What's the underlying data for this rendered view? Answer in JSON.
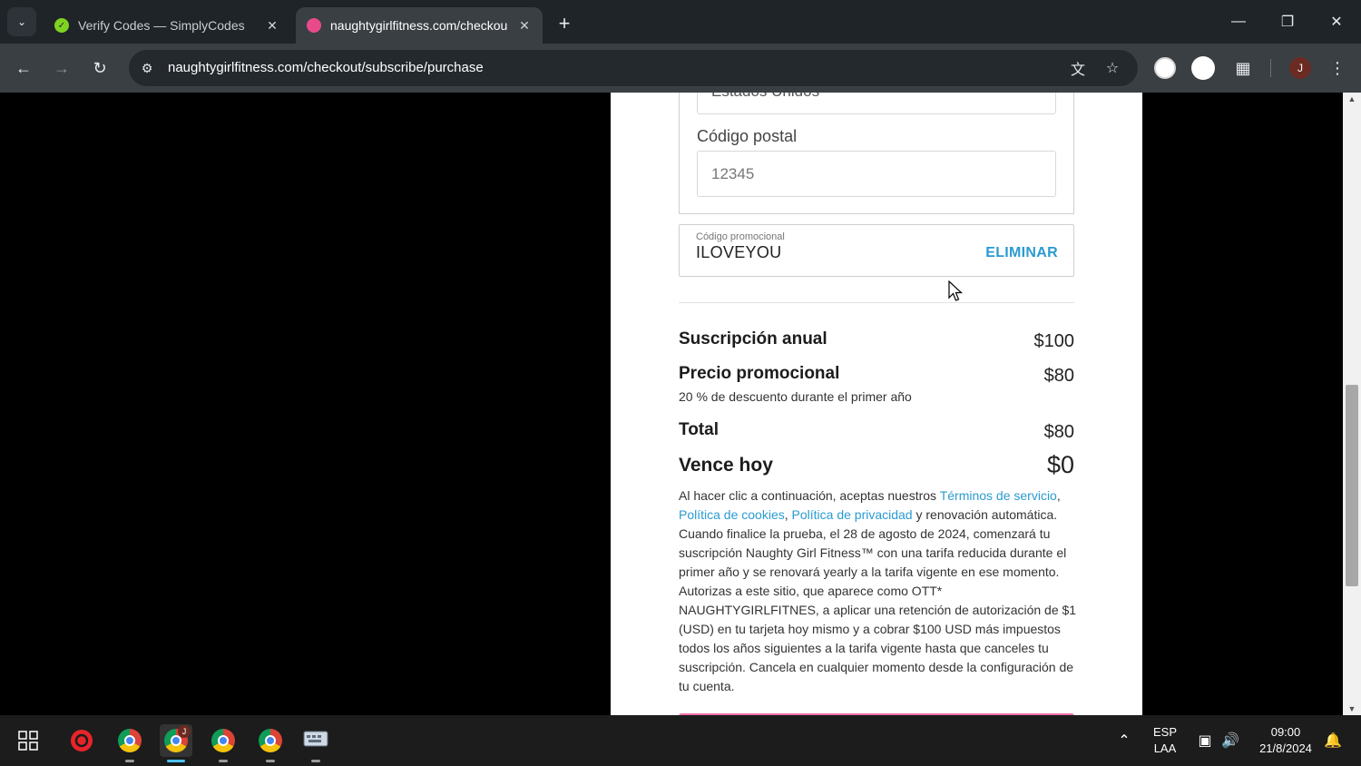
{
  "browser": {
    "tabs": [
      {
        "title": "Verify Codes — SimplyCodes",
        "favicon": "simplycodes-icon",
        "favicon_color": "#7ed321",
        "active": false
      },
      {
        "title": "naughtygirlfitness.com/checkou",
        "favicon": "lips-icon",
        "favicon_color": "#e84a8a",
        "active": true
      }
    ],
    "url": "naughtygirlfitness.com/checkout/subscribe/purchase",
    "profile_initial": "J"
  },
  "form": {
    "country_value": "Estados Unidos",
    "zip_label": "Código postal",
    "zip_placeholder": "12345",
    "promo_label": "Código promocional",
    "promo_code": "ILOVEYOU",
    "promo_remove": "ELIMINAR"
  },
  "summary": {
    "annual_label": "Suscripción anual",
    "annual_price": "$100",
    "promo_price_label": "Precio promocional",
    "promo_price": "$80",
    "promo_note": "20 % de descuento durante el primer año",
    "total_label": "Total",
    "total_price": "$80",
    "due_label": "Vence hoy",
    "due_price": "$0"
  },
  "legal": {
    "intro": "Al hacer clic a continuación, aceptas nuestros ",
    "terms": "Términos de servicio",
    "comma1": ", ",
    "cookies": "Política de cookies",
    "comma2": ", ",
    "privacy": "Política de privacidad",
    "rest": " y renovación automática. Cuando finalice la prueba, el 28 de agosto de 2024, comenzará tu suscripción Naughty Girl Fitness™ con una tarifa reducida durante el primer año y se renovará yearly a la tarifa vigente en ese momento. Autorizas a este sitio, que aparece como OTT* NAUGHTYGIRLFITNES, a aplicar una retención de autorización de $1 (USD) en tu tarjeta hoy mismo y a cobrar $100 USD más impuestos todos los años siguientes a la tarifa vigente hasta que canceles tu suscripción. Cancela en cualquier momento desde la configuración de tu cuenta."
  },
  "colors": {
    "link": "#2a9bd1",
    "primary_button": "#f06fa8"
  },
  "taskbar": {
    "lang_top": "ESP",
    "lang_bottom": "LAA",
    "time": "09:00",
    "date": "21/8/2024",
    "chrome_badge": "J"
  }
}
